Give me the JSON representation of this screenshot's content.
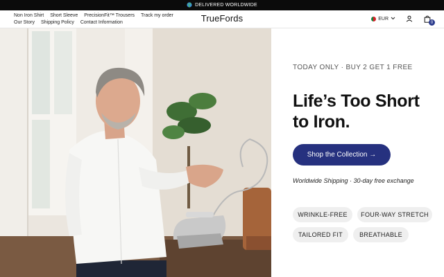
{
  "announcement": {
    "icon": "globe-icon",
    "text": "DELIVERED WORLDWIDE"
  },
  "header": {
    "nav": [
      "Non Iron Shirt",
      "Short Sleeve",
      "PrecisionFit™ Trousers",
      "Track my order",
      "Our Story",
      "Shipping Policy",
      "Contact Information"
    ],
    "logo": "TrueFords",
    "currency": "EUR",
    "account_icon": "user-icon",
    "cart_icon": "cart-icon",
    "cart_count": "0"
  },
  "hero": {
    "eyebrow": "TODAY ONLY · BUY 2 GET 1 FREE",
    "headline_line1": "Life’s Too Short",
    "headline_line2": "to Iron.",
    "cta_label": "Shop the Collection →",
    "shipping_note": "Worldwide Shipping · 30-day free exchange",
    "features": [
      "WRINKLE-FREE",
      "FOUR-WAY STRETCH",
      "TAILORED FIT",
      "BREATHABLE"
    ]
  },
  "colors": {
    "announcement_bg": "#0b0b0b",
    "cta_bg": "#26317f",
    "pill_bg": "#efefef",
    "cart_badge": "#2a3a8c"
  }
}
